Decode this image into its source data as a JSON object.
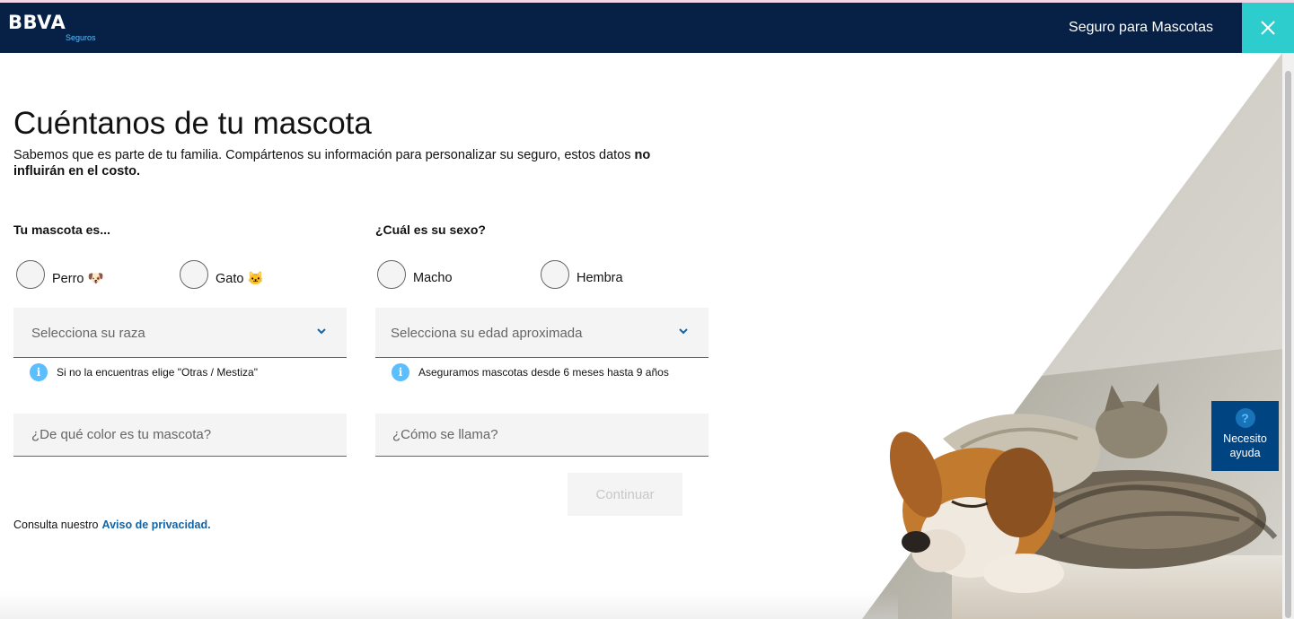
{
  "header": {
    "logo": "BBVA",
    "logo_sub": "Seguros",
    "title": "Seguro para Mascotas",
    "close_icon": "close-icon"
  },
  "main": {
    "title": "Cuéntanos de tu mascota",
    "subtitle_plain": "Sabemos que es parte de tu familia. Compártenos su información para personalizar su seguro, estos datos ",
    "subtitle_bold": "no influirán en el costo."
  },
  "pet_type": {
    "label": "Tu mascota es...",
    "options": [
      {
        "label": "Perro 🐶"
      },
      {
        "label": "Gato 🐱"
      }
    ]
  },
  "sex": {
    "label": "¿Cuál es su sexo?",
    "options": [
      {
        "label": "Macho"
      },
      {
        "label": "Hembra"
      }
    ]
  },
  "breed": {
    "placeholder": "Selecciona su raza",
    "hint": "Si no la encuentras elige \"Otras / Mestiza\""
  },
  "age": {
    "placeholder": "Selecciona su edad aproximada",
    "hint": "Aseguramos mascotas desde 6 meses hasta 9 años"
  },
  "color_field": {
    "placeholder": "¿De qué color es tu mascota?",
    "value": ""
  },
  "name_field": {
    "placeholder": "¿Cómo se llama?",
    "value": ""
  },
  "continue_label": "Continuar",
  "privacy": {
    "text": "Consulta nuestro",
    "link": "Aviso de privacidad."
  },
  "help": {
    "icon": "?",
    "label_line1": "Necesito",
    "label_line2": "ayuda"
  },
  "colors": {
    "header_bg": "#072146",
    "accent_close": "#2dcccd",
    "help_bg": "#004481",
    "info_blue": "#5bbeff",
    "link": "#1464a5"
  }
}
